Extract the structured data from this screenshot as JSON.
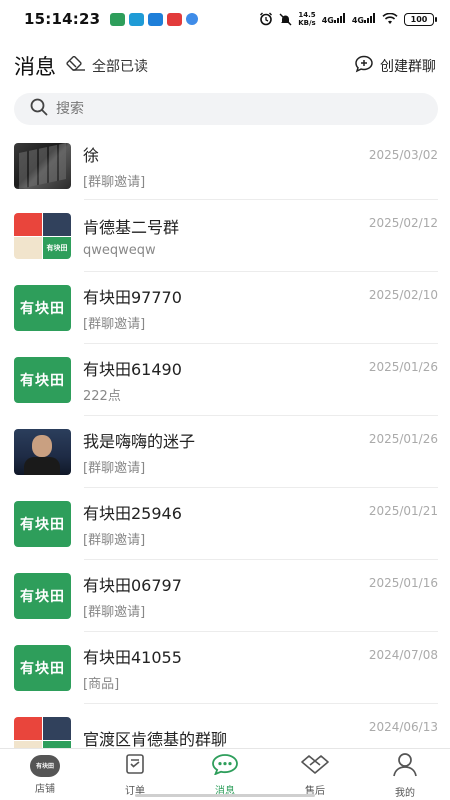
{
  "status_bar": {
    "time": "14:23",
    "time_prefix": "15:",
    "net_speed_value": "14.5",
    "net_speed_unit": "KB/s",
    "signal_1": "4G",
    "signal_2": "4G",
    "battery": "100",
    "app_colors": [
      "#2e9e5b",
      "#1f9bd6",
      "#1e7fd9",
      "#e23b3b",
      "#3f8ce8"
    ]
  },
  "header": {
    "title": "消息",
    "mark_all_read": "全部已读",
    "create_group": "创建群聊"
  },
  "search": {
    "placeholder": "搜索"
  },
  "conversations": [
    {
      "name": "徐",
      "preview": "[群聊邀请]",
      "date": "2025/03/02",
      "avatar": "photo-keyboard"
    },
    {
      "name": "肯德基二号群",
      "preview": "qweqweqw",
      "date": "2025/02/12",
      "avatar": "group-grid"
    },
    {
      "name": "有块田97770",
      "preview": "[群聊邀请]",
      "date": "2025/02/10",
      "avatar": "brand",
      "avatar_text": "有块田"
    },
    {
      "name": "有块田61490",
      "preview": "222点",
      "date": "2025/01/26",
      "avatar": "brand",
      "avatar_text": "有块田"
    },
    {
      "name": "我是嗨嗨的迷子",
      "preview": "[群聊邀请]",
      "date": "2025/01/26",
      "avatar": "photo-man"
    },
    {
      "name": "有块田25946",
      "preview": "[群聊邀请]",
      "date": "2025/01/21",
      "avatar": "brand",
      "avatar_text": "有块田"
    },
    {
      "name": "有块田06797",
      "preview": "[群聊邀请]",
      "date": "2025/01/16",
      "avatar": "brand",
      "avatar_text": "有块田"
    },
    {
      "name": "有块田41055",
      "preview": "[商品]",
      "date": "2024/07/08",
      "avatar": "brand",
      "avatar_text": "有块田"
    },
    {
      "name": "官渡区肯德基的群聊",
      "preview": "",
      "date": "2024/06/13",
      "avatar": "group-grid"
    }
  ],
  "group_avatar_tile_text": "有块田",
  "tabs": [
    {
      "label": "店铺",
      "icon": "store-icon",
      "icon_text": "有块田",
      "active": false
    },
    {
      "label": "订单",
      "icon": "order-icon",
      "active": false
    },
    {
      "label": "消息",
      "icon": "message-icon",
      "active": true
    },
    {
      "label": "售后",
      "icon": "handshake-icon",
      "active": false
    },
    {
      "label": "我的",
      "icon": "profile-icon",
      "active": false
    }
  ],
  "colors": {
    "brand_green": "#2e9e5b",
    "date_gray": "#aaaaaa",
    "preview_gray": "#888888"
  }
}
